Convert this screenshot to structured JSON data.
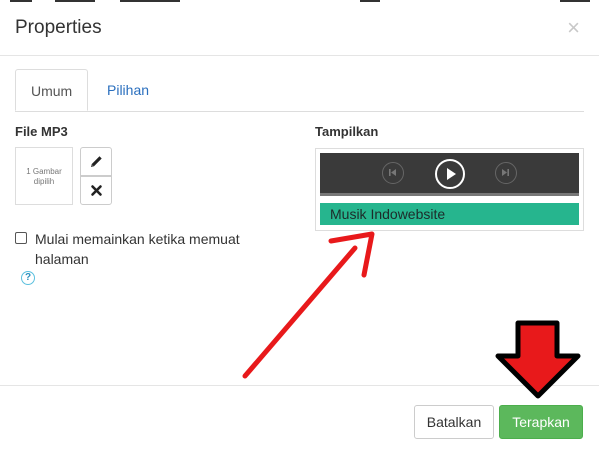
{
  "dialog": {
    "title": "Properties",
    "close_glyph": "×"
  },
  "tabs": [
    {
      "label": "Umum",
      "active": true
    },
    {
      "label": "Pilihan",
      "active": false
    }
  ],
  "left": {
    "file_label": "File MP3",
    "thumbnail_text": "1 Gambar dipilih",
    "edit_icon": "pencil-icon",
    "delete_icon": "times-icon",
    "autoplay_label": "Mulai memainkan ketika memuat halaman",
    "autoplay_checked": false,
    "help_glyph": "?"
  },
  "right": {
    "display_label": "Tampilkan",
    "track_title": "Musik Indowebsite"
  },
  "footer": {
    "cancel_label": "Batalkan",
    "apply_label": "Terapkan"
  },
  "colors": {
    "accent_green": "#5cb85c",
    "track_bar": "#26b58e",
    "player_bg": "#3a3a3a",
    "link_blue": "#2a6fbe",
    "annotation_red": "#e8191b"
  }
}
